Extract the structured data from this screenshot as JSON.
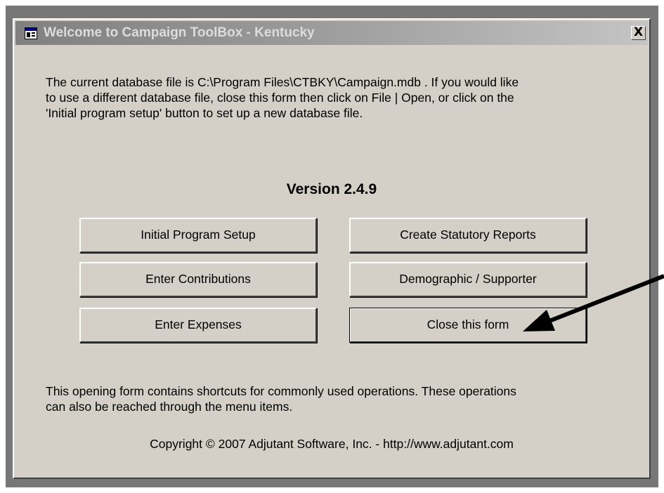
{
  "window": {
    "title": "Welcome to Campaign ToolBox - Kentucky",
    "close_label": "X"
  },
  "content": {
    "intro_line1": "The current database file is C:\\Program Files\\CTBKY\\Campaign.mdb . If you would like",
    "intro_line2": "to use a different database file, close this form then click on File | Open, or click on the",
    "intro_line3": "'Initial program setup' button to set up a new database file.",
    "version": "Version 2.4.9",
    "footer_line1": "This opening form contains shortcuts for commonly used operations. These operations",
    "footer_line2": "can also be reached through the menu items.",
    "copyright": "Copyright © 2007 Adjutant Software, Inc. - http://www.adjutant.com"
  },
  "buttons": {
    "initial_setup": "Initial Program Setup",
    "create_reports": "Create Statutory Reports",
    "enter_contributions": "Enter Contributions",
    "demographic": "Demographic / Supporter",
    "enter_expenses": "Enter Expenses",
    "close_form": "Close this form"
  },
  "icons": {
    "app": "window-app-icon",
    "close": "close-icon",
    "annotation": "annotation-arrow"
  },
  "colors": {
    "dialog_face": "#d4d0c8",
    "titlebar_inactive": "#808080",
    "frame": "#777777",
    "annotation_arrow": "#000000"
  }
}
